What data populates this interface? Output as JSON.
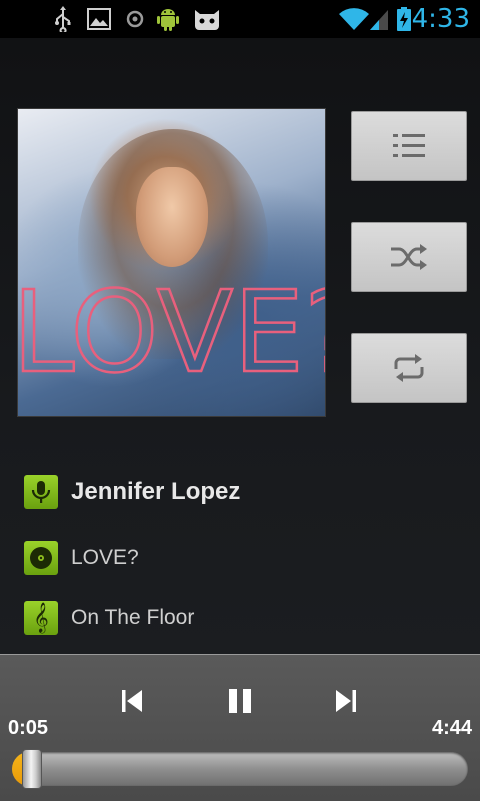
{
  "status_bar": {
    "time": "4:33",
    "icons": [
      "usb-icon",
      "gallery-icon",
      "sync-icon",
      "android-icon",
      "cyanogenmod-icon",
      "wifi-icon",
      "signal-icon",
      "battery-charging-icon"
    ],
    "accent_color": "#2fb6e8"
  },
  "now_playing": {
    "artist": "Jennifer Lopez",
    "album": "LOVE?",
    "track": "On The Floor",
    "album_art_text": "LOVE?"
  },
  "side_buttons": [
    "playlist-icon",
    "shuffle-icon",
    "repeat-icon"
  ],
  "playback": {
    "elapsed": "0:05",
    "duration": "4:44",
    "progress_fraction": 0.018,
    "seek_fill_color": "#f5b41a"
  }
}
